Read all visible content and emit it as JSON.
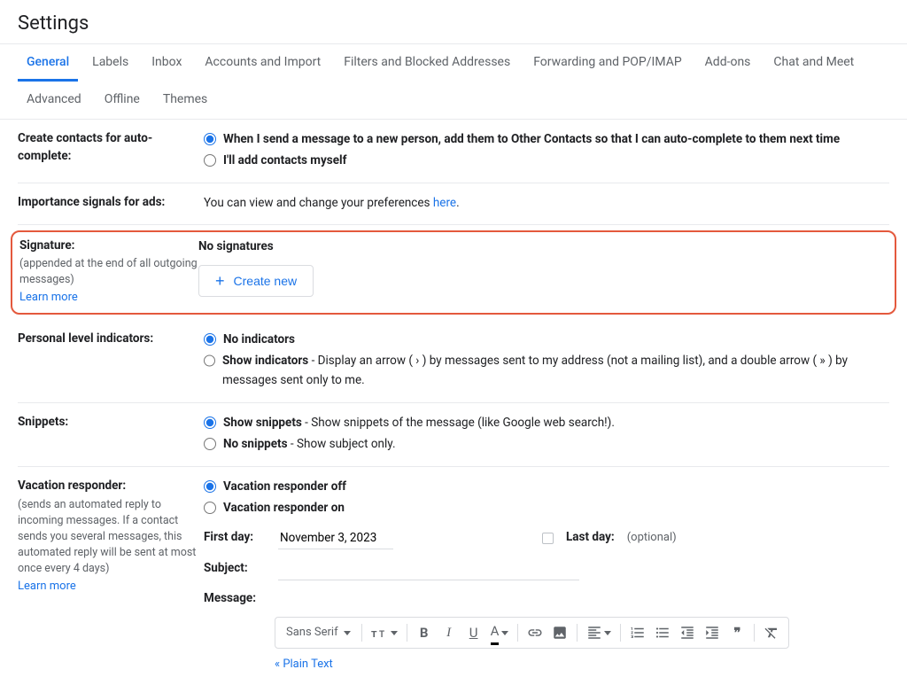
{
  "page_title": "Settings",
  "tabs": [
    "General",
    "Labels",
    "Inbox",
    "Accounts and Import",
    "Filters and Blocked Addresses",
    "Forwarding and POP/IMAP",
    "Add-ons",
    "Chat and Meet",
    "Advanced",
    "Offline",
    "Themes"
  ],
  "active_tab": "General",
  "contacts": {
    "label": "Create contacts for auto-complete:",
    "opt1": "When I send a message to a new person, add them to Other Contacts so that I can auto-complete to them next time",
    "opt2": "I'll add contacts myself"
  },
  "importance": {
    "label": "Importance signals for ads:",
    "text_before": "You can view and change your preferences ",
    "link": "here",
    "text_after": "."
  },
  "signature": {
    "label": "Signature:",
    "sub": "(appended at the end of all outgoing messages)",
    "learn": "Learn more",
    "no_sig": "No signatures",
    "create": "Create new"
  },
  "personal": {
    "label": "Personal level indicators:",
    "opt1": "No indicators",
    "opt2_bold": "Show indicators",
    "opt2_desc": " - Display an arrow ( › ) by messages sent to my address (not a mailing list), and a double arrow ( » ) by messages sent only to me."
  },
  "snippets": {
    "label": "Snippets:",
    "opt1_bold": "Show snippets",
    "opt1_desc": " - Show snippets of the message (like Google web search!).",
    "opt2_bold": "No snippets",
    "opt2_desc": " - Show subject only."
  },
  "vacation": {
    "label": "Vacation responder:",
    "sub": "(sends an automated reply to incoming messages. If a contact sends you several messages, this automated reply will be sent at most once every 4 days)",
    "learn": "Learn more",
    "opt1": "Vacation responder off",
    "opt2": "Vacation responder on",
    "first_day_label": "First day:",
    "first_day_value": "November 3, 2023",
    "last_day_label": "Last day:",
    "last_day_optional": "(optional)",
    "subject_label": "Subject:",
    "message_label": "Message:",
    "font": "Sans Serif",
    "plain_text": "« Plain Text"
  }
}
